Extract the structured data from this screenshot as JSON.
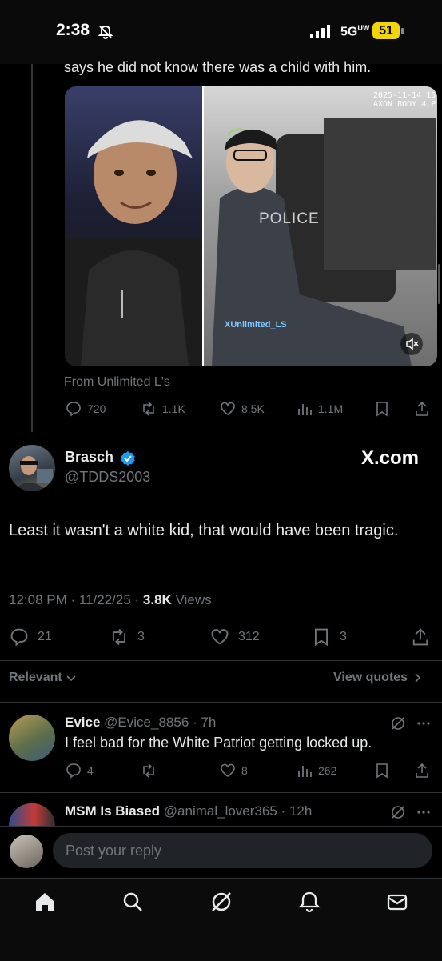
{
  "status_bar": {
    "time": "2:38",
    "network": "5G",
    "network_sup": "UW",
    "battery": "51"
  },
  "quoted_post": {
    "text_tail": "says he did not know there was a child with him.",
    "media_overlay_line1": "2025-11-14 15",
    "media_overlay_line2": "AXON BODY 4 P",
    "media_police_text": "POLICE",
    "media_watermark": "XUnlimited_LS",
    "source": "From Unlimited L's",
    "actions": {
      "replies": "720",
      "reposts": "1.1K",
      "likes": "8.5K",
      "views": "1.1M"
    }
  },
  "main_post": {
    "author_name": "Brasch",
    "handle": "@TDDS2003",
    "watermark": "X.com",
    "body": "Least it wasn't a white kid, that would have been tragic.",
    "time": "12:08 PM · 11/22/25 · ",
    "views_count": "3.8K",
    "views_label": " Views",
    "actions": {
      "replies": "21",
      "reposts": "3",
      "likes": "312",
      "bookmarks": "3"
    }
  },
  "filters": {
    "relevant_label": "Relevant",
    "view_quotes_label": "View quotes"
  },
  "replies": [
    {
      "name": "Evice",
      "handle": "@Evice_8856",
      "age": " · 7h",
      "text": "I feel bad for the White Patriot getting locked up.",
      "replies": "4",
      "reposts": "",
      "likes": "8",
      "views": "262"
    },
    {
      "name": "MSM Is Biased",
      "handle": "@animal_lover365",
      "age": " · 12h"
    }
  ],
  "composer": {
    "placeholder": "Post your reply"
  },
  "colors": {
    "background": "#000000",
    "text": "#e7e9ea",
    "muted": "#71767b",
    "verified_blue": "#1d9bf0",
    "battery": "#f2d40a"
  }
}
